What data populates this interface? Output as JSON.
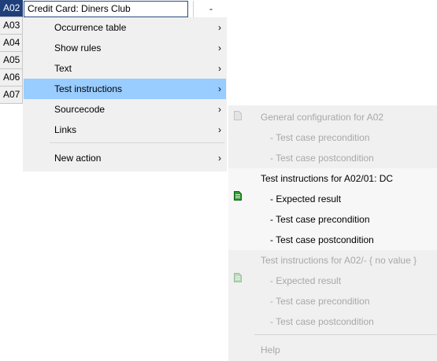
{
  "grid": {
    "rows": [
      "A02",
      "A03",
      "A04",
      "A05",
      "A06",
      "A07"
    ],
    "selected_row": "A02",
    "cell_value": "Credit Card: Diners Club",
    "second_cell": "-"
  },
  "context_menu": {
    "items": [
      {
        "label": "Occurrence table",
        "has_submenu": true
      },
      {
        "label": "Show rules",
        "has_submenu": true
      },
      {
        "label": "Text",
        "has_submenu": true
      },
      {
        "label": "Test instructions",
        "has_submenu": true,
        "highlighted": true
      },
      {
        "label": "Sourcecode",
        "has_submenu": true
      },
      {
        "label": "Links",
        "has_submenu": true
      },
      {
        "label": "New action",
        "has_submenu": true
      }
    ],
    "chevron": "›"
  },
  "submenu": {
    "general": {
      "header": "General configuration for A02",
      "items": [
        "- Test case precondition",
        "- Test case postcondition"
      ],
      "enabled": false
    },
    "instructions_dc": {
      "header": "Test instructions for A02/01:  DC",
      "items": [
        "- Expected result",
        "- Test case precondition",
        "- Test case postcondition"
      ],
      "enabled": true
    },
    "instructions_none": {
      "header": "Test instructions for A02/- { no value }",
      "items": [
        "- Expected result",
        "- Test case precondition",
        "- Test case postcondition"
      ],
      "enabled": false
    },
    "help": "Help"
  },
  "colors": {
    "menu_bg": "#f0f0f0",
    "highlight": "#99ccff",
    "selected_row": "#1e3f7a",
    "disabled_text": "#a8a8a8",
    "icon_green": "#1a7a1a"
  }
}
